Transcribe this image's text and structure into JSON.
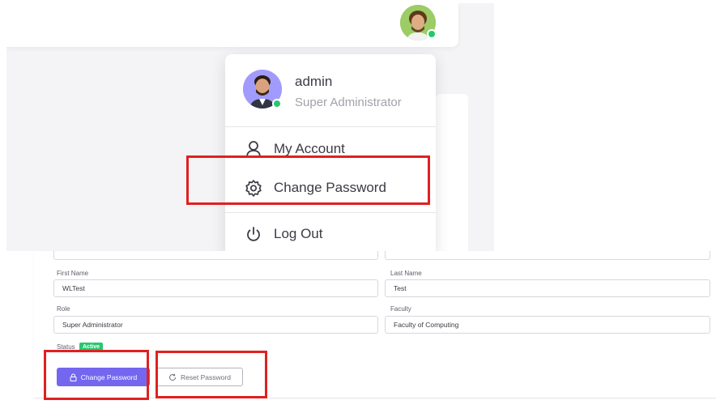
{
  "user_menu": {
    "name": "admin",
    "role": "Super Administrator",
    "items": [
      {
        "label": "My Account",
        "icon": "user-icon"
      },
      {
        "label": "Change Password",
        "icon": "gear-icon"
      },
      {
        "label": "Log Out",
        "icon": "power-icon"
      }
    ]
  },
  "form": {
    "first_name_label": "First Name",
    "first_name_value": "WLTest",
    "last_name_label": "Last Name",
    "last_name_value": "Test",
    "role_label": "Role",
    "role_value": "Super Administrator",
    "faculty_label": "Faculty",
    "faculty_value": "Faculty of Computing",
    "status_label": "Status",
    "status_value": "Active",
    "change_password_label": "Change Password",
    "reset_password_label": "Reset Password"
  },
  "colors": {
    "primary": "#7367f0",
    "success": "#28c76f",
    "highlight": "#e02020"
  }
}
